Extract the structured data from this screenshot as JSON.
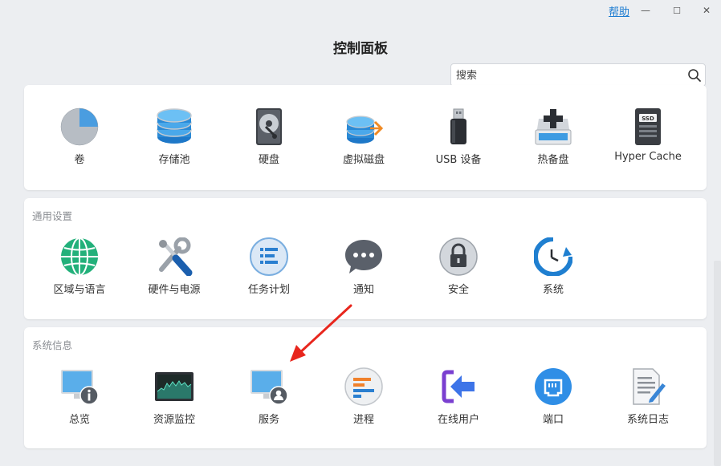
{
  "titlebar": {
    "help_label": "帮助",
    "minimize_glyph": "—",
    "maximize_glyph": "☐",
    "close_glyph": "✕"
  },
  "app_title": "控制面板",
  "search": {
    "placeholder": "搜索",
    "value": ""
  },
  "storage_panel": {
    "items": [
      {
        "label": "卷",
        "icon": "pie-chart-icon"
      },
      {
        "label": "存储池",
        "icon": "storage-pool-icon"
      },
      {
        "label": "硬盘",
        "icon": "hard-disk-icon"
      },
      {
        "label": "虚拟磁盘",
        "icon": "virtual-disk-icon"
      },
      {
        "label": "USB 设备",
        "icon": "usb-drive-icon"
      },
      {
        "label": "热备盘",
        "icon": "hot-spare-icon"
      },
      {
        "label": "Hyper Cache",
        "icon": "ssd-icon"
      }
    ]
  },
  "general_panel": {
    "title": "通用设置",
    "items": [
      {
        "label": "区域与语言",
        "icon": "globe-icon"
      },
      {
        "label": "硬件与电源",
        "icon": "tools-icon"
      },
      {
        "label": "任务计划",
        "icon": "task-list-icon"
      },
      {
        "label": "通知",
        "icon": "chat-bubble-icon"
      },
      {
        "label": "安全",
        "icon": "lock-icon"
      },
      {
        "label": "系统",
        "icon": "clock-refresh-icon"
      }
    ]
  },
  "sysinfo_panel": {
    "title": "系统信息",
    "items": [
      {
        "label": "总览",
        "icon": "monitor-info-icon"
      },
      {
        "label": "资源监控",
        "icon": "resource-monitor-icon"
      },
      {
        "label": "服务",
        "icon": "monitor-user-icon"
      },
      {
        "label": "进程",
        "icon": "process-list-icon"
      },
      {
        "label": "在线用户",
        "icon": "login-arrow-icon"
      },
      {
        "label": "端口",
        "icon": "network-port-icon"
      },
      {
        "label": "系统日志",
        "icon": "log-document-icon"
      }
    ]
  },
  "colors": {
    "accent": "#1a7bd1",
    "annotation_arrow": "#e8261d"
  }
}
